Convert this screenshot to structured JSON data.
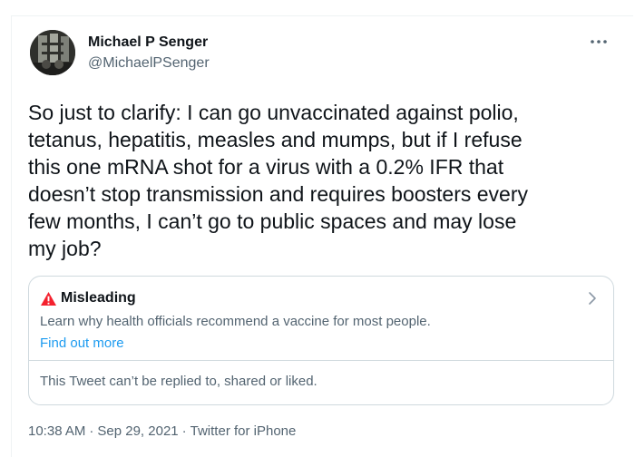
{
  "author": {
    "name": "Michael P Senger",
    "handle": "@MichaelPSenger"
  },
  "tweet": {
    "lines": [
      "So just to clarify: I can go unvaccinated against polio,",
      "tetanus, hepatitis, measles and mumps, but if I refuse",
      "this one mRNA shot for a virus with a 0.2% IFR that",
      "doesn’t stop transmission and requires boosters every",
      "few months, I can’t go to public spaces and may lose",
      "my job?"
    ]
  },
  "notice": {
    "title": "Misleading",
    "body": "Learn why health officials recommend a vaccine for most people.",
    "link": "Find out more",
    "footer": "This Tweet can’t be replied to, shared or liked.",
    "icon": "warning-triangle-icon",
    "color": "#f4212e"
  },
  "meta": {
    "time": "10:38 AM",
    "separator": "·",
    "date": "Sep 29, 2021",
    "source": "Twitter for iPhone"
  },
  "colors": {
    "text": "#0f1419",
    "secondary": "#536471",
    "link": "#1d9bf0",
    "border": "#cfd9de"
  }
}
